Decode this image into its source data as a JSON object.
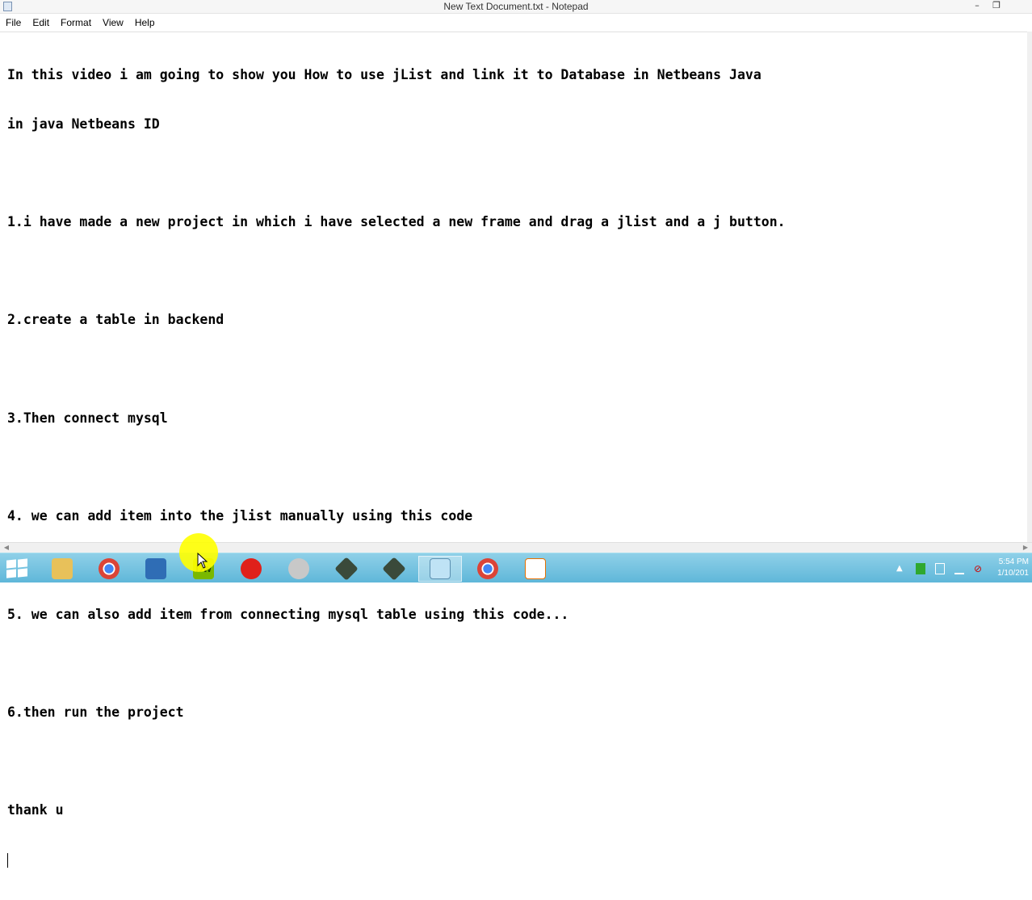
{
  "window": {
    "title": "New Text Document.txt - Notepad",
    "minimize_glyph": "–",
    "restore_glyph": "❐"
  },
  "menu": [
    "File",
    "Edit",
    "Format",
    "View",
    "Help"
  ],
  "editor": {
    "lines": [
      "In this video i am going to show you How to use jList and link it to Database in Netbeans Java",
      "in java Netbeans ID",
      "",
      "1.i have made a new project in which i have selected a new frame and drag a jlist and a j button.",
      "",
      "2.create a table in backend",
      "",
      "3.Then connect mysql",
      "",
      "4. we can add item into the jlist manually using this code",
      "",
      "5. we can also add item from connecting mysql table using this code...",
      "",
      "6.then run the project",
      "",
      "thank u"
    ]
  },
  "taskbar": {
    "apps": [
      {
        "name": "file-explorer-icon",
        "color": "#e8c15a"
      },
      {
        "name": "chrome-icon",
        "color": "#db4437"
      },
      {
        "name": "virtualbox-icon",
        "color": "#2f6db5"
      },
      {
        "name": "dreamweaver-icon",
        "color": "#7ab800",
        "label": "Dw"
      },
      {
        "name": "opera-icon",
        "color": "#e0201a"
      },
      {
        "name": "paint-icon",
        "color": "#c0c0c0"
      },
      {
        "name": "netbeans-icon",
        "color": "#3a4a3a"
      },
      {
        "name": "netbeans-alt-icon",
        "color": "#3a4a3a"
      },
      {
        "name": "notepad-icon",
        "color": "#8fc7e6"
      },
      {
        "name": "chrome-icon-2",
        "color": "#db4437"
      },
      {
        "name": "java-icon",
        "color": "#ffffff"
      }
    ],
    "clock_time": "5:54 PM",
    "clock_date": "1/10/201"
  }
}
